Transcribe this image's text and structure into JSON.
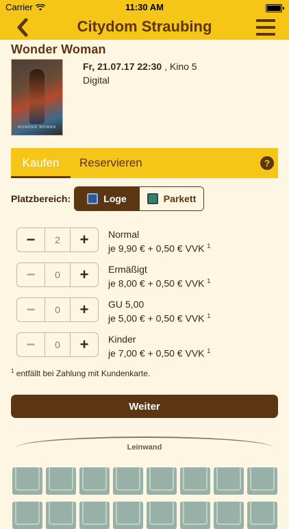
{
  "status": {
    "carrier": "Carrier",
    "time": "11:30 AM"
  },
  "nav": {
    "title": "Citydom Straubing",
    "back_icon": "chevron-left-icon",
    "menu_icon": "hamburger-menu-icon"
  },
  "movie": {
    "title": "Wonder Woman",
    "poster_caption": "WONDER WOMAN",
    "date": "Fr, 21.07.17 22:30",
    "hall": ", Kino 5",
    "format": "Digital"
  },
  "tabs": {
    "buy": "Kaufen",
    "reserve": "Reservieren",
    "help_icon": "?"
  },
  "area": {
    "label": "Platzbereich:",
    "options": [
      "Loge",
      "Parkett"
    ],
    "selected": "Loge"
  },
  "tickets": [
    {
      "name": "Normal",
      "price": "je 9,90 € + 0,50 € VVK",
      "note": "1",
      "qty": "2"
    },
    {
      "name": "Ermäßigt",
      "price": "je 8,00 € + 0,50 € VVK",
      "note": "1",
      "qty": "0"
    },
    {
      "name": "GU 5,00",
      "price": "je 5,00 € + 0,50 € VVK",
      "note": "1",
      "qty": "0"
    },
    {
      "name": "Kinder",
      "price": "je 7,00 € + 0,50 € VVK",
      "note": "1",
      "qty": "0"
    }
  ],
  "footnote": {
    "mark": "1",
    "text": " entfällt bei Zahlung mit Kundenkarte."
  },
  "continue_label": "Weiter",
  "screen_label": "Leinwand",
  "colors": {
    "accent": "#f5c518",
    "brown": "#5c3512",
    "background": "#fdf6e3",
    "seat": "#97b0a8"
  }
}
